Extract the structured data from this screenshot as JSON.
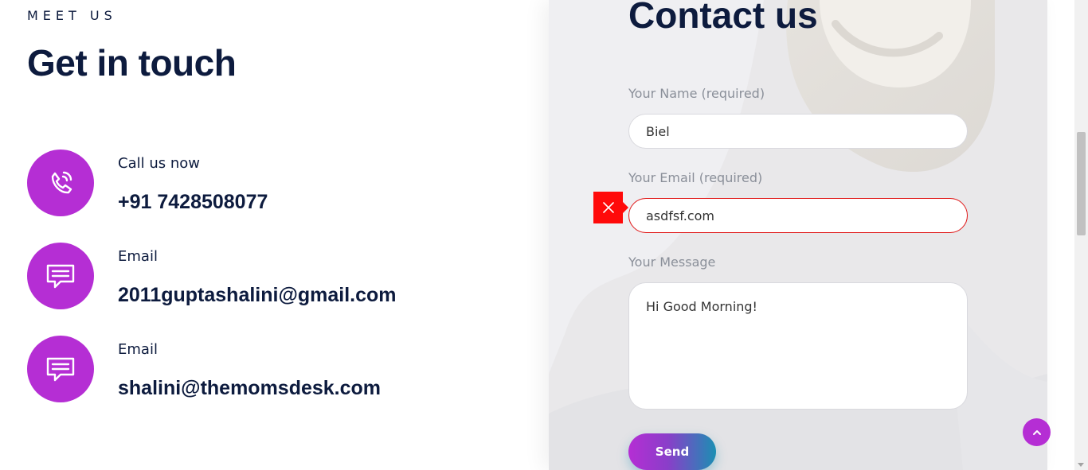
{
  "meet": {
    "eyebrow": "MEET US",
    "heading": "Get in touch"
  },
  "contacts": [
    {
      "label": "Call us now",
      "value": "+91 7428508077",
      "icon": "phone-icon"
    },
    {
      "label": "Email",
      "value": "2011guptashalini@gmail.com",
      "icon": "chat-icon"
    },
    {
      "label": "Email",
      "value": "shalini@themomsdesk.com",
      "icon": "chat-icon"
    }
  ],
  "form": {
    "title": "Contact us",
    "name_label": "Your Name (required)",
    "name_value": "Biel",
    "email_label": "Your Email (required)",
    "email_value": "asdfsf.com",
    "message_label": "Your Message",
    "message_value": "Hi Good Morning!",
    "send_label": "Send"
  },
  "colors": {
    "accent": "#b52ed4",
    "heading": "#0d1b3e",
    "error": "#ff0a0a",
    "send_gradient_end": "#1b8fb3"
  },
  "icons": {
    "error": "close-icon",
    "scroll_top": "chevron-up-icon"
  }
}
